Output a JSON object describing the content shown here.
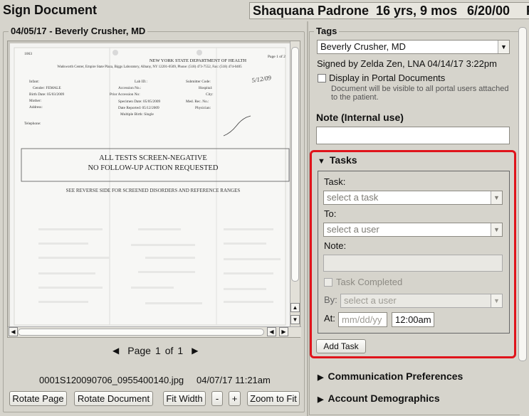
{
  "app": {
    "title": "Sign Document"
  },
  "patient": {
    "name": "Shaquana Padrone",
    "age": "16 yrs, 9 mos",
    "dob": "6/20/00",
    "overflow": "F"
  },
  "document": {
    "legend": "04/05/17 - Beverly Crusher, MD",
    "scan": {
      "page_label": "Page 1 of 2",
      "id": "1063",
      "dept": "NEW YORK STATE DEPARTMENT OF HEALTH",
      "address": "Wadsworth Center, Empire State Plaza, Biggs Laboratory, Albany, NY 12201-0509, Phone: (518) 473-7552,  Fax: (518) 474-0405",
      "handwritten_date": "5/12/09",
      "fields_left": [
        "Infant:",
        "Gender: FEMALE",
        "Birth Date: 05/03/2009",
        "Mother:",
        "Address:"
      ],
      "fields_mid": [
        "Lab ID.:",
        "Accession No.:",
        "Prior Accession No:",
        "Specimen Date: 05/05/2009",
        "Date Reported: 05/12/2009",
        "Multiple Birth: Single"
      ],
      "fields_right": [
        "Submitter Code:",
        "Hospital:",
        "City:",
        "Med. Rec. No.:",
        "Physician:"
      ],
      "telephone": "Telephone:",
      "result_line1": "ALL TESTS SCREEN-NEGATIVE",
      "result_line2": "NO FOLLOW-UP ACTION REQUESTED",
      "reverse_note": "SEE REVERSE SIDE FOR SCREENED DISORDERS AND REFERENCE RANGES"
    },
    "pager": {
      "page_word": "Page",
      "current": "1",
      "of_word": "of",
      "total": "1"
    },
    "filename": "0001S120090706_0955400140.jpg",
    "file_date": "04/07/17 11:21am",
    "buttons": {
      "rotate_page": "Rotate Page",
      "rotate_document": "Rotate Document",
      "fit_width": "Fit Width",
      "zoom_out": "-",
      "zoom_in": "+",
      "zoom_to_fit": "Zoom to Fit"
    }
  },
  "tags": {
    "legend": "Tags",
    "provider": "Beverly Crusher, MD",
    "signed_by": "Signed by Zelda Zen, LNA 04/14/17 3:22pm",
    "portal_label": "Display in Portal Documents",
    "portal_help": "Document will be visible to all portal users attached to the patient.",
    "note_label": "Note (Internal use)",
    "note_value": ""
  },
  "tasks": {
    "header": "Tasks",
    "task_label": "Task:",
    "task_placeholder": "select a task",
    "to_label": "To:",
    "to_placeholder": "select a user",
    "note_label": "Note:",
    "completed_label": "Task Completed",
    "by_label": "By:",
    "by_placeholder": "select a user",
    "at_label": "At:",
    "date_placeholder": "mm/dd/yy",
    "time_value": "12:00am",
    "add_button": "Add Task"
  },
  "sections": {
    "communication": "Communication Preferences",
    "demographics": "Account Demographics"
  },
  "colors": {
    "highlight": "#e0141b",
    "panel_bg": "#d6d4cc"
  }
}
